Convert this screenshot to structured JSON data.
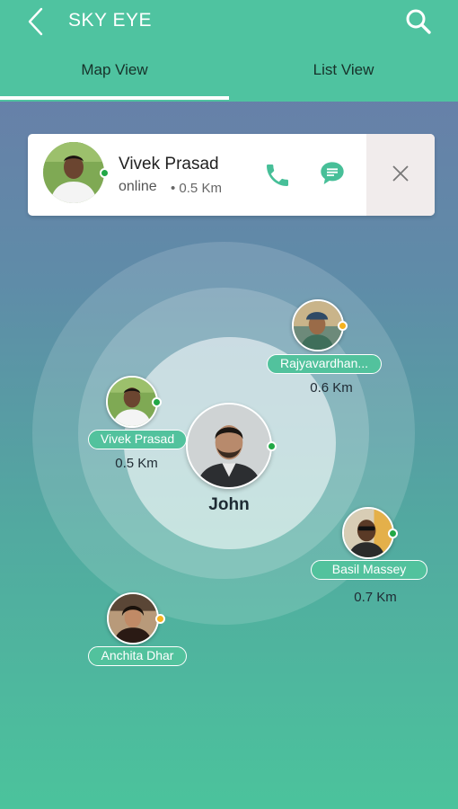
{
  "header": {
    "title": "SKY EYE",
    "tabs": [
      {
        "label": "Map View",
        "active": true
      },
      {
        "label": "List View",
        "active": false
      }
    ]
  },
  "card": {
    "name": "Vivek Prasad",
    "status": "online",
    "distance": "• 0.5 Km",
    "status_color": "#21a846"
  },
  "center_user": {
    "name": "John",
    "status_color": "#21a846"
  },
  "people": [
    {
      "name": "Rajyavardhan...",
      "distance": "0.6 Km",
      "status_color": "#f5b21f"
    },
    {
      "name": "Vivek Prasad",
      "distance": "0.5 Km",
      "status_color": "#21a846"
    },
    {
      "name": "Basil Massey",
      "distance": "0.7 Km",
      "status_color": "#21a846"
    },
    {
      "name": "Anchita Dhar",
      "distance": "",
      "status_color": "#f5b21f"
    }
  ],
  "icons": {
    "back": "chevron-left-icon",
    "search": "search-icon",
    "call": "phone-icon",
    "chat": "chat-bubble-icon",
    "close": "close-icon"
  },
  "colors": {
    "accent": "#4fc3a0",
    "label_bg": "#52c29d",
    "online": "#21a846",
    "away": "#f5b21f"
  }
}
